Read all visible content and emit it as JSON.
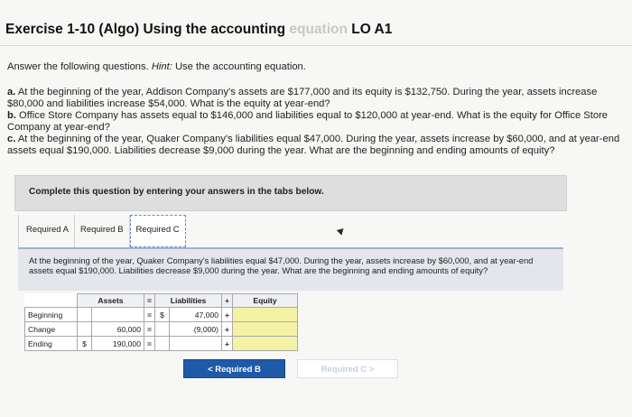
{
  "header": {
    "title_start": "Exercise 1-10 (Algo) Using the accounting ",
    "title_faded": "equation",
    "title_end": " LO A1"
  },
  "intro": {
    "text": "Answer the following questions. ",
    "hint_label": "Hint:",
    "hint_text": " Use the accounting equation."
  },
  "questions": [
    {
      "label": "a.",
      "text": " At the beginning of the year, Addison Company's assets are $177,000 and its equity is $132,750. During the year, assets increase $80,000 and liabilities increase $54,000. What is the equity at year-end?"
    },
    {
      "label": "b.",
      "text": " Office Store Company has assets equal to $146,000 and liabilities equal to $120,000 at year-end. What is the equity for Office Store Company at year-end?"
    },
    {
      "label": "c.",
      "text": " At the beginning of the year, Quaker Company's liabilities equal $47,000. During the year, assets increase by $60,000, and at year-end assets equal $190,000. Liabilities decrease $9,000 during the year. What are the beginning and ending amounts of equity?"
    }
  ],
  "instruction": "Complete this question by entering your answers in the tabs below.",
  "tabs": [
    "Required A",
    "Required B",
    "Required C"
  ],
  "active_tab": "Required C",
  "panel_text": "At the beginning of the year, Quaker Company's liabilities equal $47,000. During the year, assets increase by $60,000, and at year-end assets equal $190,000. Liabilities decrease $9,000 during the year. What are the beginning and ending amounts of equity?",
  "equation_table": {
    "headers": {
      "assets": "Assets",
      "eq": "=",
      "liabilities": "Liabilities",
      "plus": "+",
      "equity": "Equity"
    },
    "rows": [
      {
        "label": "Beginning",
        "assets_dollar": "",
        "assets": "",
        "eq": "=",
        "liab_dollar": "$",
        "liabilities": "47,000",
        "plus": "+",
        "equity": ""
      },
      {
        "label": "Change",
        "assets_dollar": "",
        "assets": "60,000",
        "eq": "=",
        "liab_dollar": "",
        "liabilities": "(9,000)",
        "plus": "+",
        "equity": ""
      },
      {
        "label": "Ending",
        "assets_dollar": "$",
        "assets": "190,000",
        "eq": "=",
        "liab_dollar": "",
        "liabilities": "",
        "plus": "+",
        "equity": ""
      }
    ]
  },
  "nav": {
    "prev_label": "<  Required B",
    "next_label": "Required C  >"
  },
  "colors": {
    "primary_button": "#1f5aa8",
    "input_highlight": "#f4f2a4",
    "panel_bg": "#e4e6ec"
  }
}
